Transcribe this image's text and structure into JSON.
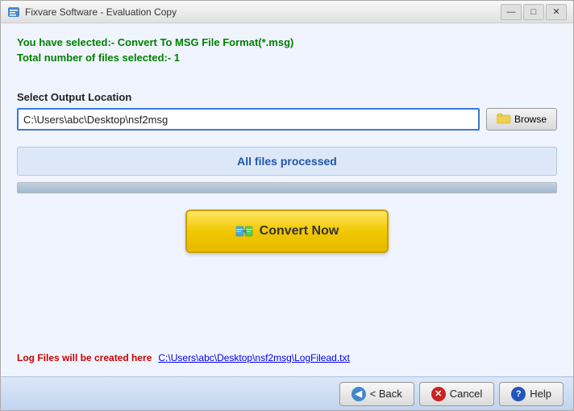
{
  "window": {
    "title": "Fixvare Software - Evaluation Copy",
    "icon": "🔧"
  },
  "info": {
    "line1": "You have selected:- Convert To MSG File Format(*.msg)",
    "line2": "Total number of files selected:- 1"
  },
  "output": {
    "label": "Select Output Location",
    "path": "C:\\Users\\abc\\Desktop\\nsf2msg",
    "placeholder": "Output path"
  },
  "browse": {
    "label": "Browse"
  },
  "status": {
    "text": "All files processed"
  },
  "convert": {
    "label": "Convert Now"
  },
  "log": {
    "label": "Log Files will be created here",
    "link": "C:\\Users\\abc\\Desktop\\nsf2msg\\LogFilead.txt"
  },
  "footer": {
    "back_label": "< Back",
    "cancel_label": "Cancel",
    "help_label": "Help"
  },
  "colors": {
    "accent": "#3a7bd5",
    "green": "#008000",
    "red": "#cc0000"
  }
}
